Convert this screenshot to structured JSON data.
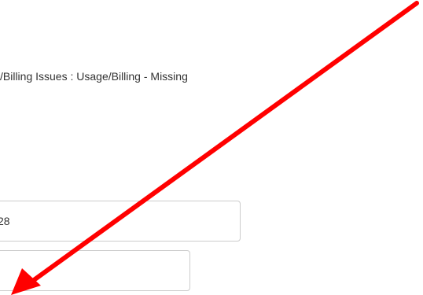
{
  "case": {
    "category_text": "/Billing Issues : Usage/Billing - Missing"
  },
  "fields": {
    "field_1_value": "28",
    "field_2_value": ""
  },
  "annotation": {
    "arrow_color": "#ff0000",
    "arrow_icon": "red-arrow-annotation"
  }
}
